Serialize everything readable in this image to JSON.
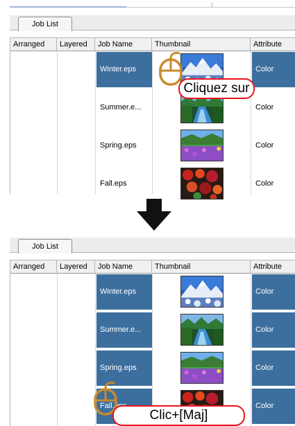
{
  "panels": [
    {
      "tab": "Job List",
      "columns": [
        "Arranged",
        "Layered",
        "Job Name",
        "Thumbnail",
        "Attribute"
      ],
      "rows": [
        {
          "name": "Winter.eps",
          "attribute": "Color",
          "thumbnail": "winter-mountain-thumbnail",
          "selected": true
        },
        {
          "name": "Summer.e...",
          "attribute": "Color",
          "thumbnail": "summer-river-thumbnail",
          "selected": false
        },
        {
          "name": "Spring.eps",
          "attribute": "Color",
          "thumbnail": "spring-flowers-thumbnail",
          "selected": false
        },
        {
          "name": "Fall.eps",
          "attribute": "Color",
          "thumbnail": "fall-leaves-thumbnail",
          "selected": false
        }
      ],
      "callout": "Cliquez sur"
    },
    {
      "tab": "Job List",
      "columns": [
        "Arranged",
        "Layered",
        "Job Name",
        "Thumbnail",
        "Attribute"
      ],
      "rows": [
        {
          "name": "Winter.eps",
          "attribute": "Color",
          "thumbnail": "winter-mountain-thumbnail",
          "selected": true
        },
        {
          "name": "Summer.e...",
          "attribute": "Color",
          "thumbnail": "summer-river-thumbnail",
          "selected": true
        },
        {
          "name": "Spring.eps",
          "attribute": "Color",
          "thumbnail": "spring-flowers-thumbnail",
          "selected": true
        },
        {
          "name": "Fall.eps",
          "attribute": "Color",
          "thumbnail": "fall-leaves-thumbnail",
          "selected": true
        }
      ],
      "callout": "Clic+[Maj]"
    }
  ],
  "icons": {
    "mouse": "mouse-icon",
    "arrow": "arrow-down-icon"
  },
  "colors": {
    "selection": "#3d6f9e",
    "callout_border": "#e8141c",
    "mouse": "#c98a2b",
    "arrow": "#111111"
  }
}
